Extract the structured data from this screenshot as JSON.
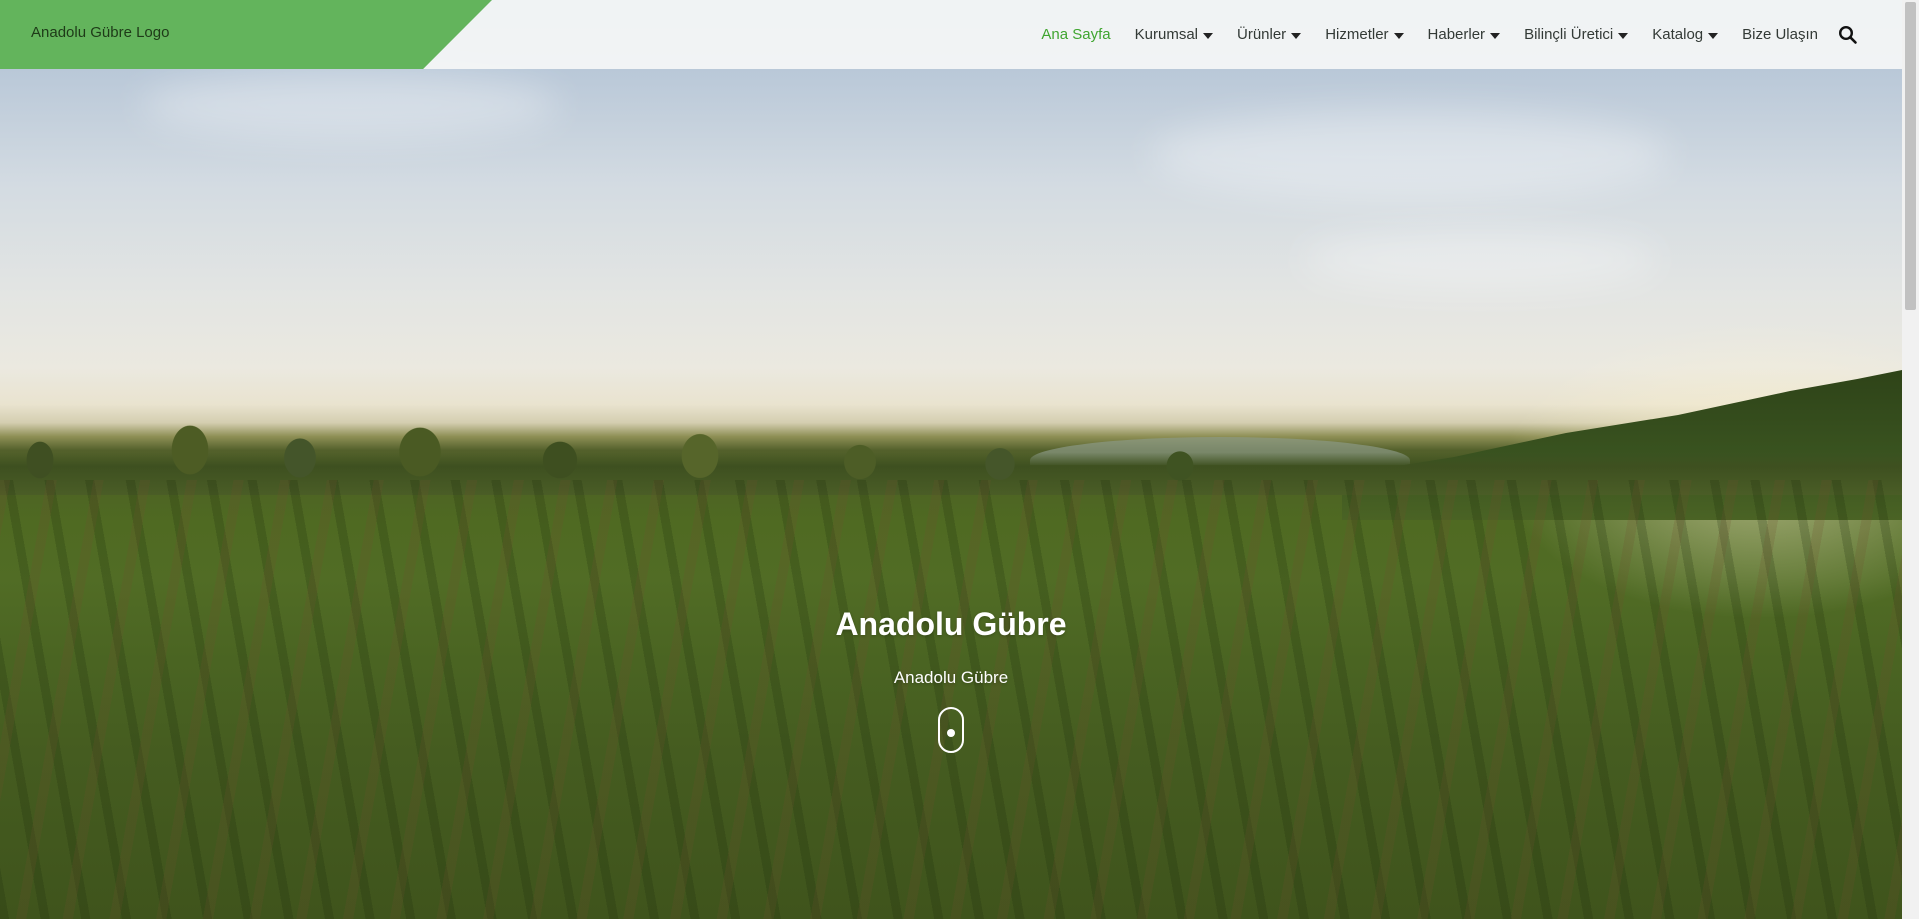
{
  "header": {
    "logo_text": "Anadolu Gübre Logo",
    "nav": [
      {
        "label": "Ana Sayfa",
        "active": true,
        "dropdown": false
      },
      {
        "label": "Kurumsal",
        "dropdown": true
      },
      {
        "label": "Ürünler",
        "dropdown": true
      },
      {
        "label": "Hizmetler",
        "dropdown": true
      },
      {
        "label": "Haberler",
        "dropdown": true
      },
      {
        "label": "Bilinçli Üretici",
        "dropdown": true
      },
      {
        "label": "Katalog",
        "dropdown": true
      },
      {
        "label": "Bize Ulaşın",
        "dropdown": false
      }
    ],
    "search_icon": "search-icon"
  },
  "hero": {
    "title": "Anadolu Gübre",
    "subtitle": "Anadolu Gübre",
    "scroll_icon": "mouse-scroll-icon"
  },
  "colors": {
    "brand_green": "#63b45c",
    "active_nav": "#3fa52f",
    "nav_text": "#333a36"
  }
}
